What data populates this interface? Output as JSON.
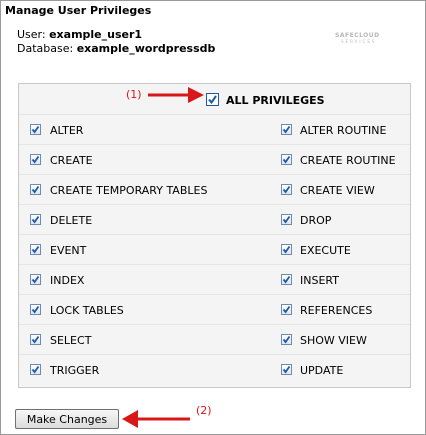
{
  "title": "Manage User Privileges",
  "user": {
    "label": "User:",
    "value": "example_user1"
  },
  "database": {
    "label": "Database:",
    "value": "example_wordpressdb"
  },
  "watermark": {
    "main": "SAFECLOUD",
    "sub": "SERVICES"
  },
  "all_privileges": {
    "label": "ALL PRIVILEGES",
    "checked": true
  },
  "privileges_left": [
    {
      "label": "ALTER",
      "checked": true
    },
    {
      "label": "CREATE",
      "checked": true
    },
    {
      "label": "CREATE TEMPORARY TABLES",
      "checked": true
    },
    {
      "label": "DELETE",
      "checked": true
    },
    {
      "label": "EVENT",
      "checked": true
    },
    {
      "label": "INDEX",
      "checked": true
    },
    {
      "label": "LOCK TABLES",
      "checked": true
    },
    {
      "label": "SELECT",
      "checked": true
    },
    {
      "label": "TRIGGER",
      "checked": true
    }
  ],
  "privileges_right": [
    {
      "label": "ALTER ROUTINE",
      "checked": true
    },
    {
      "label": "CREATE ROUTINE",
      "checked": true
    },
    {
      "label": "CREATE VIEW",
      "checked": true
    },
    {
      "label": "DROP",
      "checked": true
    },
    {
      "label": "EXECUTE",
      "checked": true
    },
    {
      "label": "INSERT",
      "checked": true
    },
    {
      "label": "REFERENCES",
      "checked": true
    },
    {
      "label": "SHOW VIEW",
      "checked": true
    },
    {
      "label": "UPDATE",
      "checked": true
    }
  ],
  "annotations": {
    "one": "(1)",
    "two": "(2)"
  },
  "make_changes_label": "Make Changes",
  "colors": {
    "annotation": "#d81818",
    "check": "#1c5aa8"
  }
}
